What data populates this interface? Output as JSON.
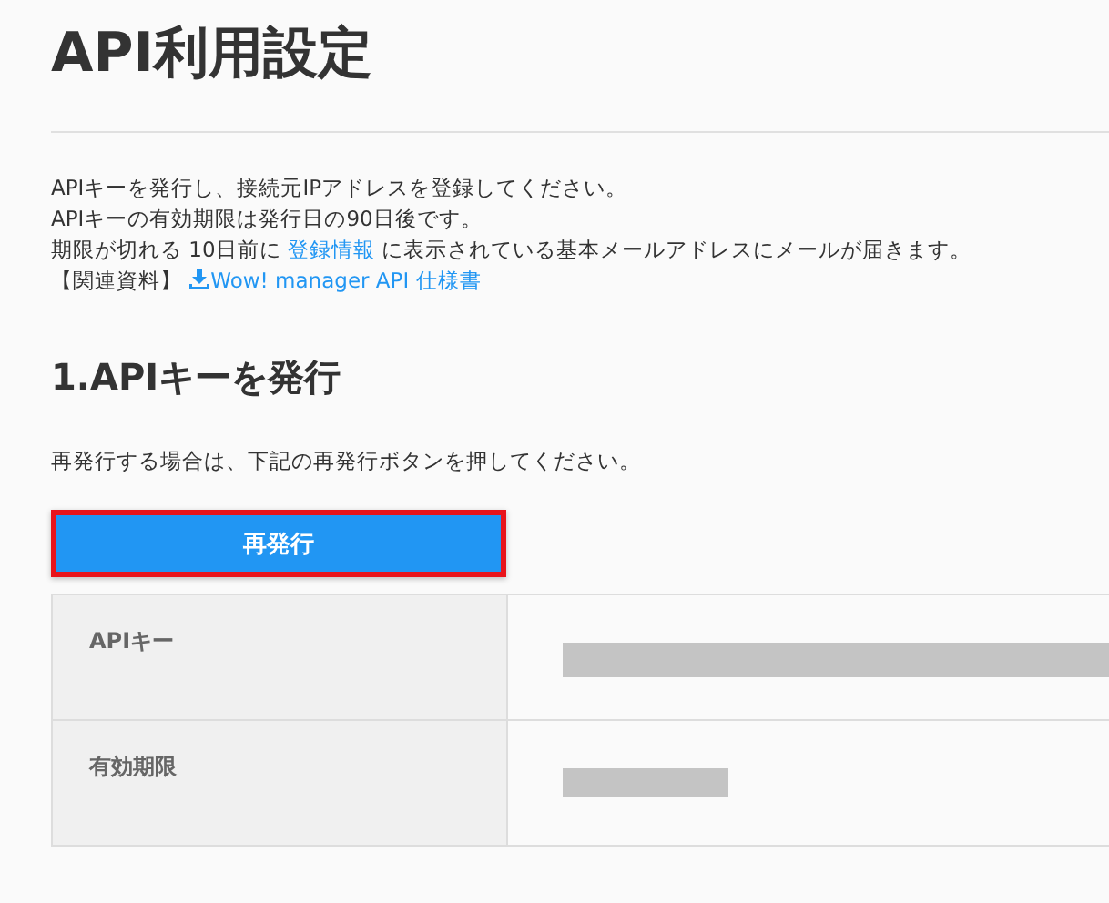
{
  "title": "API利用設定",
  "intro": [
    {
      "parts": [
        {
          "kind": "text",
          "text": "APIキーを発行し、接続元IPアドレスを登録してください。"
        }
      ]
    },
    {
      "parts": [
        {
          "kind": "text",
          "text": "APIキーの有効期限は発行日の90日後です。"
        }
      ]
    },
    {
      "parts": [
        {
          "kind": "text",
          "text": "期限が切れる 10日前に "
        },
        {
          "kind": "link",
          "text": "登録情報"
        },
        {
          "kind": "text",
          "text": " に表示されている基本メールアドレスにメールが届きます。"
        }
      ]
    },
    {
      "parts": [
        {
          "kind": "text",
          "text": "【関連資料】 "
        },
        {
          "kind": "download_link",
          "text": "Wow! manager API 仕様書"
        }
      ]
    }
  ],
  "section": {
    "heading": "1.APIキーを発行",
    "instruction": "再発行する場合は、下記の再発行ボタンを押してください。",
    "button": {
      "label": "再発行",
      "highlighted": true
    },
    "table": {
      "rows": [
        {
          "label": "APIキー",
          "value": {
            "kind": "redacted_long"
          }
        },
        {
          "label": "有効期限",
          "value": {
            "kind": "redacted_short"
          }
        }
      ]
    }
  }
}
